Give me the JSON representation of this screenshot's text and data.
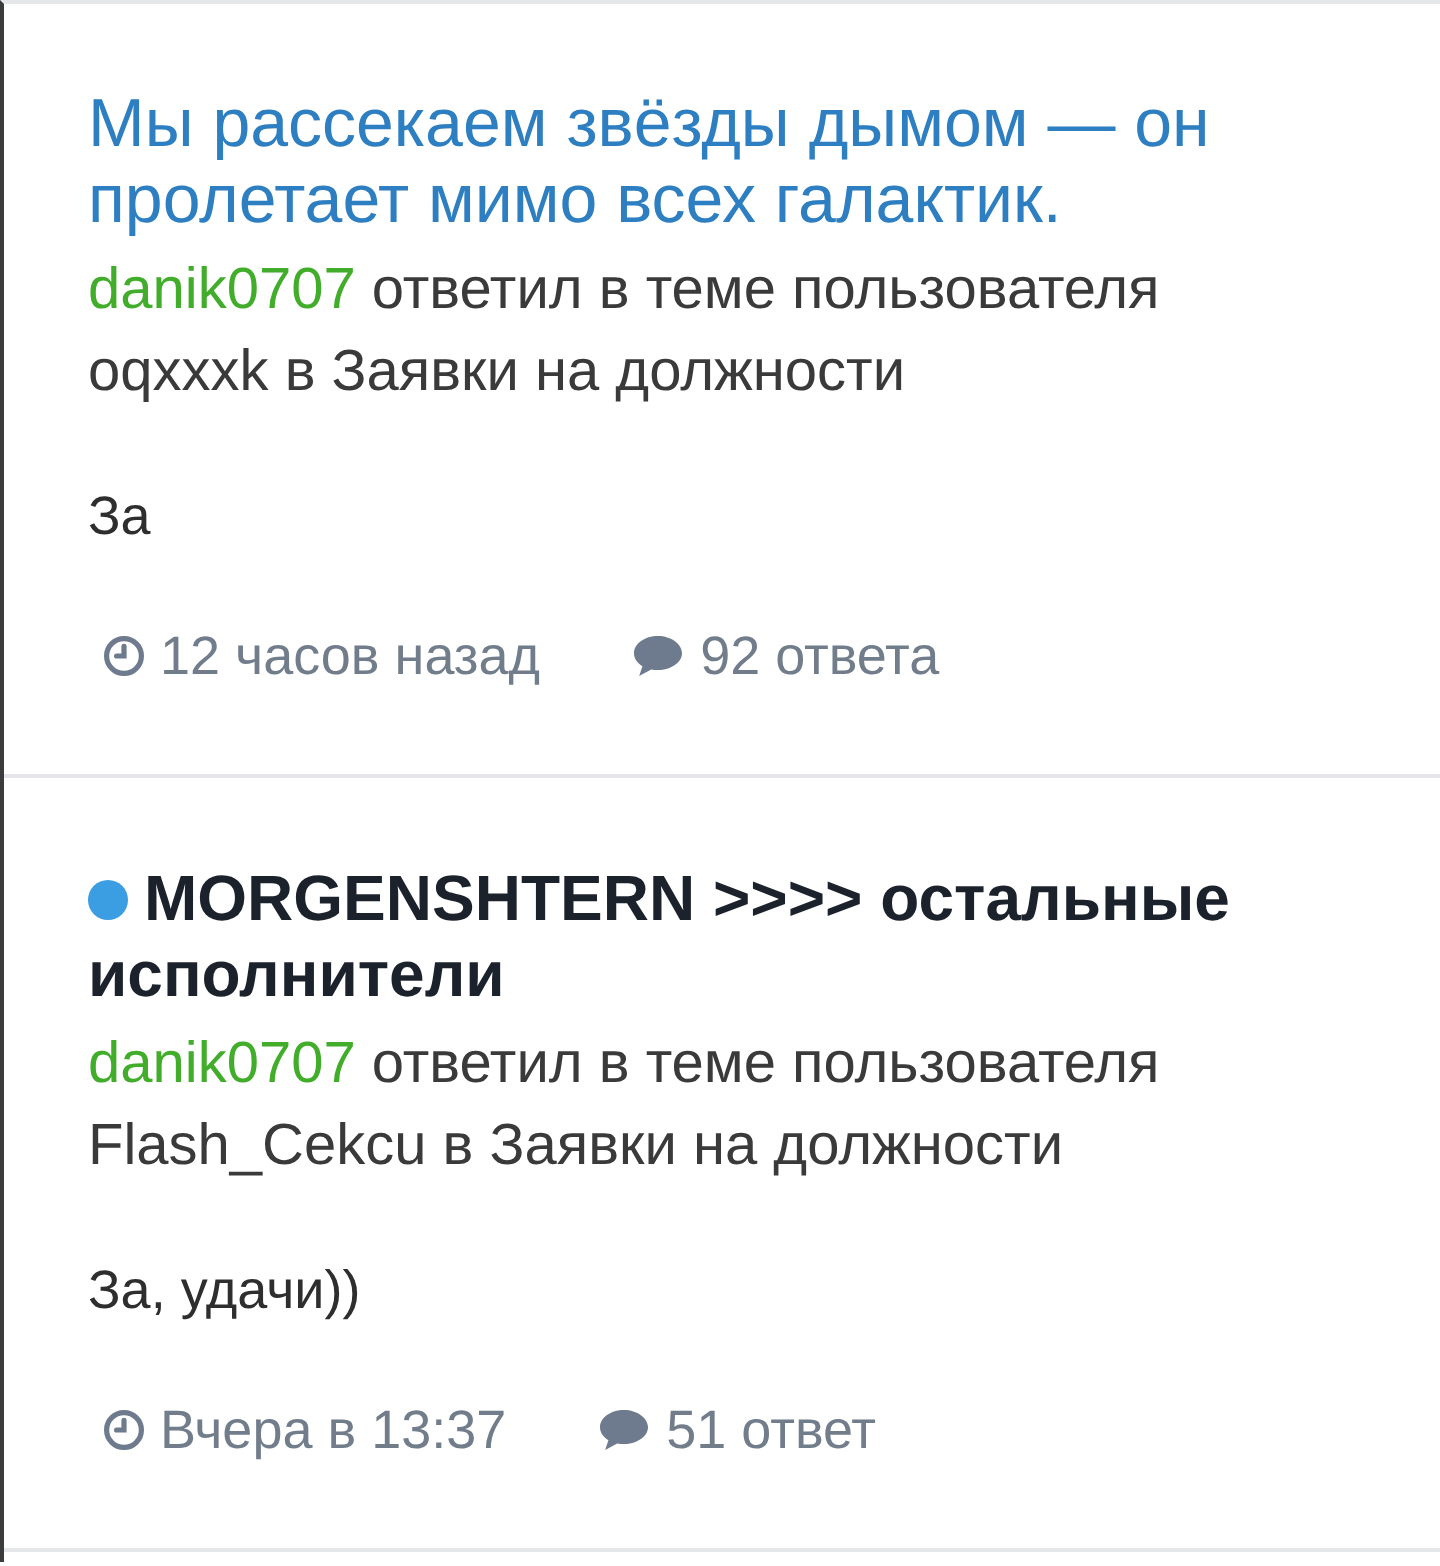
{
  "threads": [
    {
      "title": "Мы рассекаем звёзды дымом — он пролетает мимо всех галактик.",
      "unread": false,
      "author": "danik0707",
      "action": "ответил в теме пользователя oqxxxk в Заявки на должности",
      "snippet": "За",
      "time": "12 часов назад",
      "replies": "92 ответа"
    },
    {
      "title": "MORGENSHTERN >>>> остальные исполнители",
      "unread": true,
      "author": "danik0707",
      "action": "ответил в теме пользователя Flash_Cekcu в Заявки на должности",
      "snippet": "За, удачи))",
      "time": "Вчера в 13:37",
      "replies": "51 ответ"
    }
  ]
}
